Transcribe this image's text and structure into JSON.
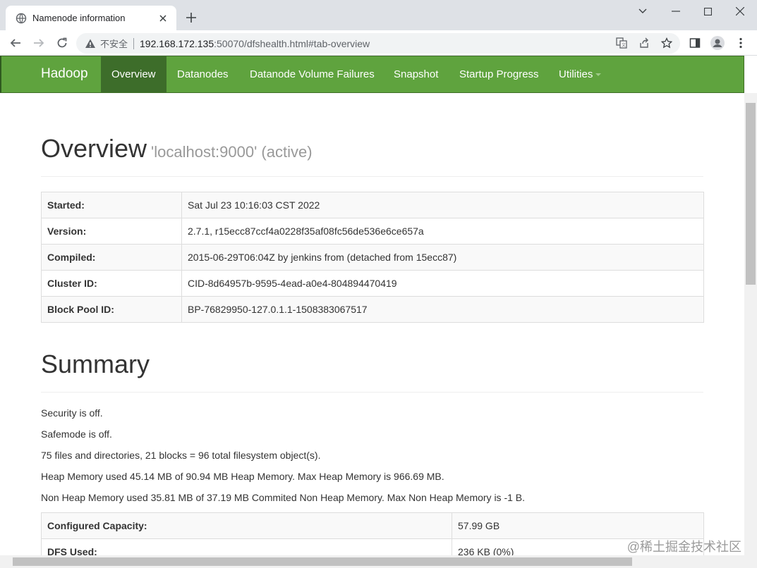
{
  "browser": {
    "tab_title": "Namenode information",
    "security_label": "不安全",
    "url_host": "192.168.172.135",
    "url_rest": ":50070/dfshealth.html#tab-overview"
  },
  "navbar": {
    "brand": "Hadoop",
    "items": [
      "Overview",
      "Datanodes",
      "Datanode Volume Failures",
      "Snapshot",
      "Startup Progress",
      "Utilities"
    ],
    "active": "Overview"
  },
  "overview": {
    "title": "Overview",
    "subtitle": "'localhost:9000' (active)",
    "rows": [
      {
        "label": "Started:",
        "value": "Sat Jul 23 10:16:03 CST 2022"
      },
      {
        "label": "Version:",
        "value": "2.7.1, r15ecc87ccf4a0228f35af08fc56de536e6ce657a"
      },
      {
        "label": "Compiled:",
        "value": "2015-06-29T06:04Z by jenkins from (detached from 15ecc87)"
      },
      {
        "label": "Cluster ID:",
        "value": "CID-8d64957b-9595-4ead-a0e4-804894470419"
      },
      {
        "label": "Block Pool ID:",
        "value": "BP-76829950-127.0.1.1-1508383067517"
      }
    ]
  },
  "summary": {
    "title": "Summary",
    "lines": [
      "Security is off.",
      "Safemode is off.",
      "75 files and directories, 21 blocks = 96 total filesystem object(s).",
      "Heap Memory used 45.14 MB of 90.94 MB Heap Memory. Max Heap Memory is 966.69 MB.",
      "Non Heap Memory used 35.81 MB of 37.19 MB Commited Non Heap Memory. Max Non Heap Memory is -1 B."
    ],
    "rows": [
      {
        "label": "Configured Capacity:",
        "value": "57.99 GB"
      },
      {
        "label": "DFS Used:",
        "value": "236 KB (0%)"
      }
    ]
  },
  "watermark": "@稀土掘金技术社区",
  "colors": {
    "navbar": "#5fa33e",
    "navbar_active": "#3d6d2a"
  }
}
